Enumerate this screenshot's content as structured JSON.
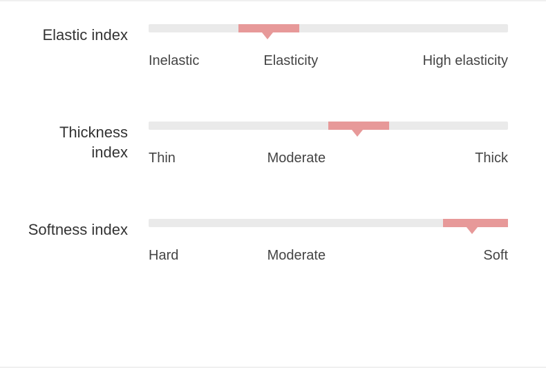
{
  "chart_data": {
    "type": "bar",
    "title": "",
    "series": [
      {
        "name": "Elastic index",
        "value": 33,
        "range_start": 25,
        "range_end": 42,
        "categories": [
          "Inelastic",
          "Elasticity",
          "High elasticity"
        ]
      },
      {
        "name": "Thickness index",
        "value": 58,
        "range_start": 50,
        "range_end": 67,
        "categories": [
          "Thin",
          "Moderate",
          "Thick"
        ]
      },
      {
        "name": "Softness index",
        "value": 90,
        "range_start": 82,
        "range_end": 100,
        "categories": [
          "Hard",
          "Moderate",
          "Soft"
        ]
      }
    ],
    "xlim": [
      0,
      100
    ]
  },
  "indices": {
    "elastic": {
      "label": "Elastic index",
      "ticks": {
        "left": "Inelastic",
        "mid": "Elasticity",
        "right": "High elasticity"
      },
      "fill_left": "25%",
      "fill_width": "17%",
      "pointer_left": "33%",
      "mid_pos": "32%",
      "left_pos": "0%",
      "right_pos": "100%"
    },
    "thickness": {
      "label": "Thickness index",
      "ticks": {
        "left": "Thin",
        "mid": "Moderate",
        "right": "Thick"
      },
      "fill_left": "50%",
      "fill_width": "17%",
      "pointer_left": "58%",
      "mid_pos": "33%",
      "left_pos": "0%",
      "right_pos": "100%"
    },
    "softness": {
      "label": "Softness index",
      "ticks": {
        "left": "Hard",
        "mid": "Moderate",
        "right": "Soft"
      },
      "fill_left": "82%",
      "fill_width": "18%",
      "pointer_left": "90%",
      "mid_pos": "33%",
      "left_pos": "0%",
      "right_pos": "100%"
    }
  }
}
